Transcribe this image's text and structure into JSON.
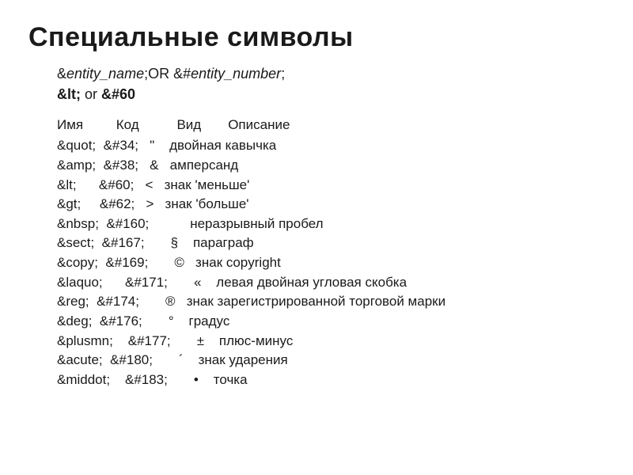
{
  "title": "Специальные символы",
  "syntax": {
    "line1_prefix": "&",
    "line1_ital1": "entity_name",
    "line1_mid": ";OR &#",
    "line1_ital2": "entity_number",
    "line1_suffix": ";",
    "line2_bold": "&lt;",
    "line2_mid": " or ",
    "line2_bold2": "&#60"
  },
  "headers": {
    "name": "Имя",
    "code": "Код",
    "view": "Вид",
    "desc": "Описание"
  },
  "rows": [
    "&quot;  &#34;   \"    двойная кавычка",
    "&amp;  &#38;   &   амперсанд",
    "&lt;      &#60;   <   знак 'меньше'",
    "&gt;     &#62;   >   знак 'больше'",
    "&nbsp;  &#160;           неразрывный пробел",
    "&sect;  &#167;       §    параграф",
    "&copy;  &#169;       ©   знак copyright",
    "&laquo;      &#171;       «    левая двойная угловая скобка",
    "&reg;  &#174;       ®   знак зарегистрированной торговой марки",
    "&deg;  &#176;       °    градус",
    "&plusmn;    &#177;       ±    плюс-минус",
    "&acute;  &#180;       ´    знак ударения",
    "&middot;    &#183;       •    точка"
  ]
}
